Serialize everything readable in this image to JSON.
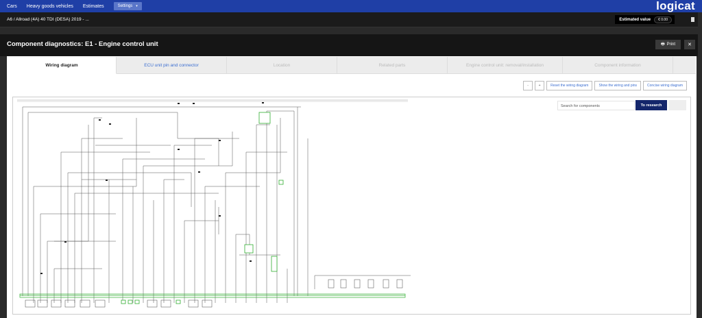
{
  "topnav": {
    "items": [
      "Cars",
      "Heavy goods vehicles",
      "Estimates"
    ],
    "settings_label": "Settings",
    "logo": "logicat"
  },
  "subbar": {
    "vehicle": "A6 / Allroad (4A) 40 TDI (DESA) 2019 - ...",
    "estimated_label": "Estimated value",
    "estimated_value": "€ 0.00"
  },
  "header": {
    "title": "Component diagnostics: E1 - Engine control unit",
    "print_label": "Print",
    "close_label": "✕"
  },
  "tabs": [
    {
      "label": "Wiring diagram",
      "state": "active"
    },
    {
      "label": "ECU unit pin and connector",
      "state": "link"
    },
    {
      "label": "Location",
      "state": "disabled"
    },
    {
      "label": "Related parts",
      "state": "disabled"
    },
    {
      "label": "Engine control unit: removal/installation",
      "state": "disabled"
    },
    {
      "label": "Component information",
      "state": "disabled"
    }
  ],
  "controls": {
    "zoom_out": "-",
    "zoom_in": "+",
    "reset": "Reset the wiring diagram",
    "show_pins": "Show the wiring and pins",
    "concise": "Concise wiring diagram"
  },
  "search": {
    "placeholder": "Search for components",
    "button": "To research"
  },
  "colors": {
    "nav_blue": "#1f3fa6",
    "research_navy": "#14266b",
    "wire_green": "#2fae2f"
  }
}
